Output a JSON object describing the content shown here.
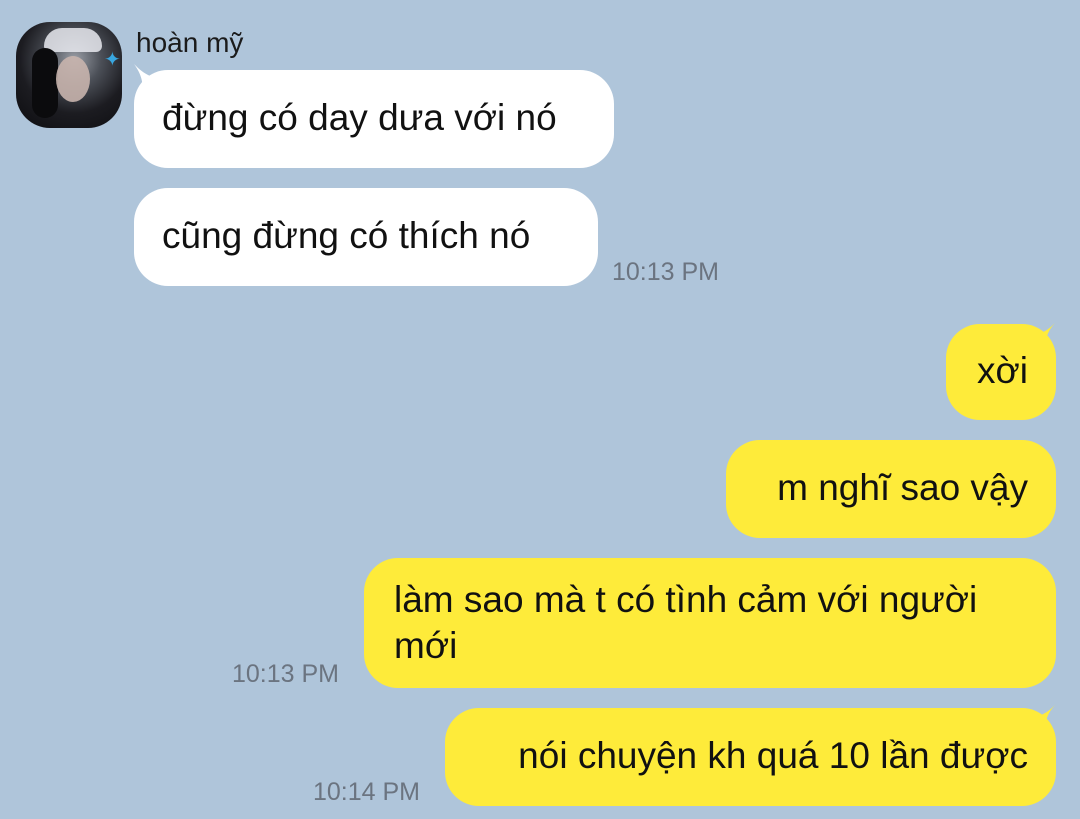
{
  "contact": {
    "name": "hoàn mỹ"
  },
  "messages": {
    "m0": {
      "text": "đừng có day dưa với nó"
    },
    "m1": {
      "text": "cũng đừng có thích nó",
      "time": "10:13 PM"
    },
    "m2": {
      "text": "xời"
    },
    "m3": {
      "text": "m nghĩ sao vậy"
    },
    "m4": {
      "text": "làm sao mà t có tình cảm với người mới",
      "time": "10:13 PM"
    },
    "m5": {
      "text": "nói chuyện kh quá 10 lần được",
      "time": "10:14 PM"
    }
  },
  "colors": {
    "background": "#afc5da",
    "incoming_bubble": "#ffffff",
    "outgoing_bubble": "#feeb3a",
    "timestamp": "#6b7480"
  }
}
